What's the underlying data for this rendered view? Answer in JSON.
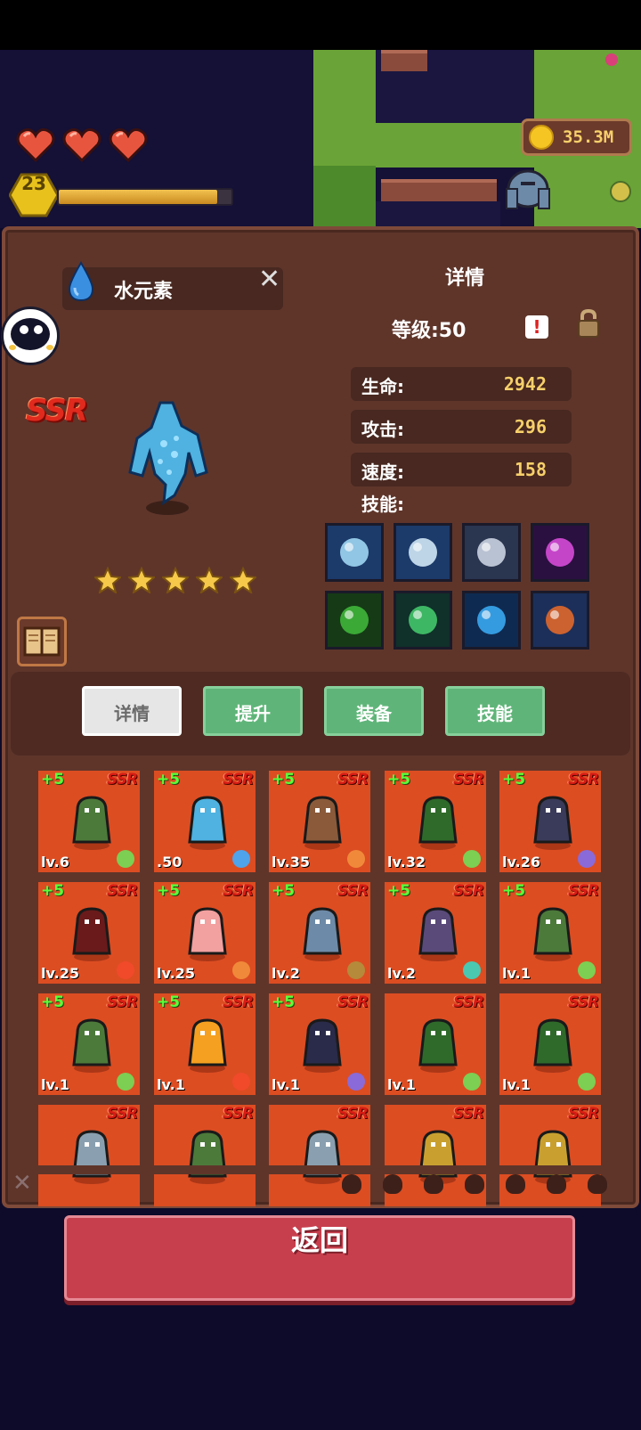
{
  "hud": {
    "hearts": 3,
    "player_level": "23",
    "xp_fraction": 0.92,
    "coins": "35.3M"
  },
  "unit": {
    "name": "水元素",
    "rarity": "SSR",
    "stars": 5,
    "detail_title": "详情",
    "level_text": "等级:50",
    "stats": [
      {
        "label": "生命:",
        "value": "2942"
      },
      {
        "label": "攻击:",
        "value": "296"
      },
      {
        "label": "速度:",
        "value": "158"
      }
    ],
    "skills_label": "技能:",
    "skills": [
      {
        "icon": "ice-crystal-icon",
        "color": "#9fd6f2"
      },
      {
        "icon": "spiral-wind-icon",
        "color": "#cfe7f5"
      },
      {
        "icon": "ice-shard-icon",
        "color": "#c9d2e0"
      },
      {
        "icon": "dark-orb-icon",
        "color": "#d64bd8"
      },
      {
        "icon": "poison-slime-icon",
        "color": "#3fb63a"
      },
      {
        "icon": "green-crescent-icon",
        "color": "#44c66a"
      },
      {
        "icon": "water-vortex-icon",
        "color": "#3aa7f0"
      },
      {
        "icon": "fire-staff-icon",
        "color": "#e0682a"
      }
    ]
  },
  "tabs": [
    {
      "label": "详情",
      "active": true
    },
    {
      "label": "提升",
      "active": false
    },
    {
      "label": "装备",
      "active": false
    },
    {
      "label": "技能",
      "active": false
    }
  ],
  "heroes": [
    {
      "plus": "+5",
      "rarity": "SSR",
      "lv": "lv.6",
      "element": "leaf",
      "monster": "goblin-knight"
    },
    {
      "plus": "+5",
      "rarity": "SSR",
      "lv": ".50",
      "element": "water",
      "monster": "water-elemental"
    },
    {
      "plus": "+5",
      "rarity": "SSR",
      "lv": "lv.35",
      "element": "sun",
      "monster": "centaur"
    },
    {
      "plus": "+5",
      "rarity": "SSR",
      "lv": "lv.32",
      "element": "leaf",
      "monster": "treant"
    },
    {
      "plus": "+5",
      "rarity": "SSR",
      "lv": "lv.26",
      "element": "moon",
      "monster": "reaper"
    },
    {
      "plus": "+5",
      "rarity": "SSR",
      "lv": "lv.25",
      "element": "fire",
      "monster": "demon-lord"
    },
    {
      "plus": "+5",
      "rarity": "SSR",
      "lv": "lv.25",
      "element": "sun",
      "monster": "fairy"
    },
    {
      "plus": "+5",
      "rarity": "SSR",
      "lv": "lv.2",
      "element": "earth",
      "monster": "stone-golem"
    },
    {
      "plus": "+5",
      "rarity": "SSR",
      "lv": "lv.2",
      "element": "wind",
      "monster": "bat"
    },
    {
      "plus": "+5",
      "rarity": "SSR",
      "lv": "lv.1",
      "element": "leaf",
      "monster": "goblin-knight"
    },
    {
      "plus": "+5",
      "rarity": "SSR",
      "lv": "lv.1",
      "element": "leaf",
      "monster": "goblin-knight"
    },
    {
      "plus": "+5",
      "rarity": "SSR",
      "lv": "lv.1",
      "element": "fire",
      "monster": "fire-spirit"
    },
    {
      "plus": "+5",
      "rarity": "SSR",
      "lv": "lv.1",
      "element": "moon",
      "monster": "dark-knight"
    },
    {
      "plus": "",
      "rarity": "SSR",
      "lv": "lv.1",
      "element": "leaf",
      "monster": "treant"
    },
    {
      "plus": "",
      "rarity": "SSR",
      "lv": "lv.1",
      "element": "leaf",
      "monster": "treant"
    },
    {
      "plus": "",
      "rarity": "SSR",
      "lv": "",
      "element": "",
      "monster": "gray-cat"
    },
    {
      "plus": "",
      "rarity": "SSR",
      "lv": "",
      "element": "",
      "monster": "goblin-knight"
    },
    {
      "plus": "",
      "rarity": "SSR",
      "lv": "",
      "element": "",
      "monster": "gray-cat"
    },
    {
      "plus": "",
      "rarity": "SSR",
      "lv": "",
      "element": "",
      "monster": "golden-shell"
    },
    {
      "plus": "",
      "rarity": "SSR",
      "lv": "",
      "element": "",
      "monster": "golden-shell"
    }
  ],
  "filters": [
    "leaf",
    "earth",
    "water",
    "wind",
    "fire",
    "sun",
    "moon"
  ],
  "back_label": "返回"
}
